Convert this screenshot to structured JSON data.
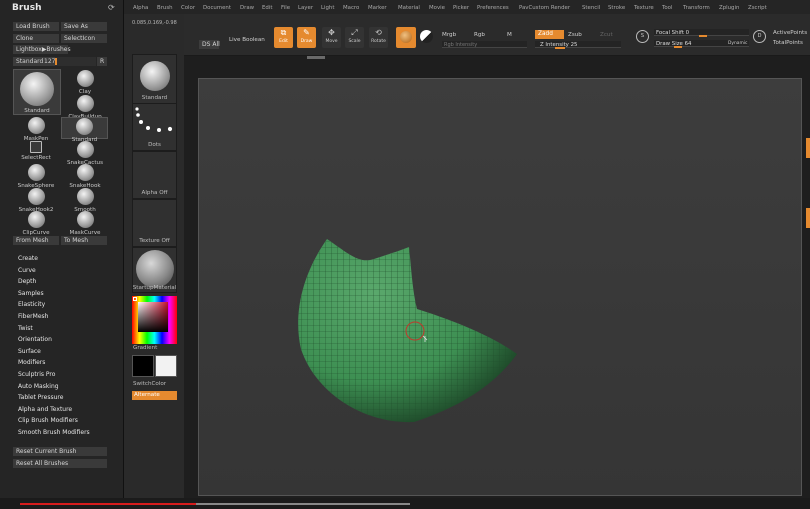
{
  "brush_panel": {
    "title": "Brush",
    "top_buttons": [
      "Load Brush",
      "Save As",
      "Clone",
      "SelectIcon",
      "Lightbox▶Brushes"
    ],
    "standard_slider": {
      "label": "Standard",
      "value": "127",
      "reset": "R",
      "level": 0.5
    },
    "brushes": [
      "Standard",
      "Clay",
      "ClayBuildup",
      "MaskPen",
      "Standard",
      "SelectRect",
      "SnakeCactus",
      "SnakeSphere",
      "SnakeHook",
      "SnakeHook2",
      "Smooth",
      "ClipCurve",
      "MaskCurve"
    ],
    "mesh_buttons": [
      "From Mesh",
      "To Mesh"
    ],
    "sections": [
      "Create",
      "Curve",
      "Depth",
      "Samples",
      "Elasticity",
      "FiberMesh",
      "Twist",
      "Orientation",
      "Surface",
      "Modifiers",
      "Sculptris Pro",
      "Auto Masking",
      "Tablet Pressure",
      "Alpha and Texture",
      "Clip Brush Modifiers",
      "Smooth Brush Modifiers"
    ],
    "reset_buttons": [
      "Reset Current Brush",
      "Reset All Brushes"
    ]
  },
  "shelf": {
    "slots": [
      "Standard",
      "Dots",
      "Alpha Off",
      "Texture Off",
      "StartupMaterial"
    ],
    "gradient_label": "Gradient",
    "switch_color_label": "SwitchColor",
    "alternate_label": "Alternate",
    "status_readout": "0.085,0.169,-0.98"
  },
  "top_menu": [
    "Alpha",
    "Brush",
    "Color",
    "Document",
    "Draw",
    "Edit",
    "File",
    "Layer",
    "Light",
    "Macro",
    "Marker",
    "Material",
    "Movie",
    "Picker",
    "Preferences",
    "PavCustom Render",
    "Stencil",
    "Stroke",
    "Texture",
    "Tool",
    "Transform",
    "Zplugin",
    "Zscript"
  ],
  "toolbar": {
    "ds_all": "DS All",
    "live_boolean": "Live Boolean",
    "tools": [
      "Edit",
      "Draw",
      "Move",
      "Scale",
      "Rotate"
    ],
    "mrgb": "Mrgb",
    "rgb": "Rgb",
    "m": "M",
    "zadd": "Zadd",
    "zsub": "Zsub",
    "zcut": "Zcut",
    "rgb_intensity": "Rgb Intensity",
    "z_intensity": "Z Intensity 25",
    "focal_shift": "Focal Shift 0",
    "draw_size": "Draw Size 64",
    "dynamic": "Dynamic",
    "active_points": "ActivePoints",
    "total_points": "TotalPoints"
  },
  "colors": {
    "accent": "#e58a2f",
    "mesh": "#3d8f52",
    "progress": "#d61c1c"
  },
  "progress": {
    "fraction": 0.45
  }
}
